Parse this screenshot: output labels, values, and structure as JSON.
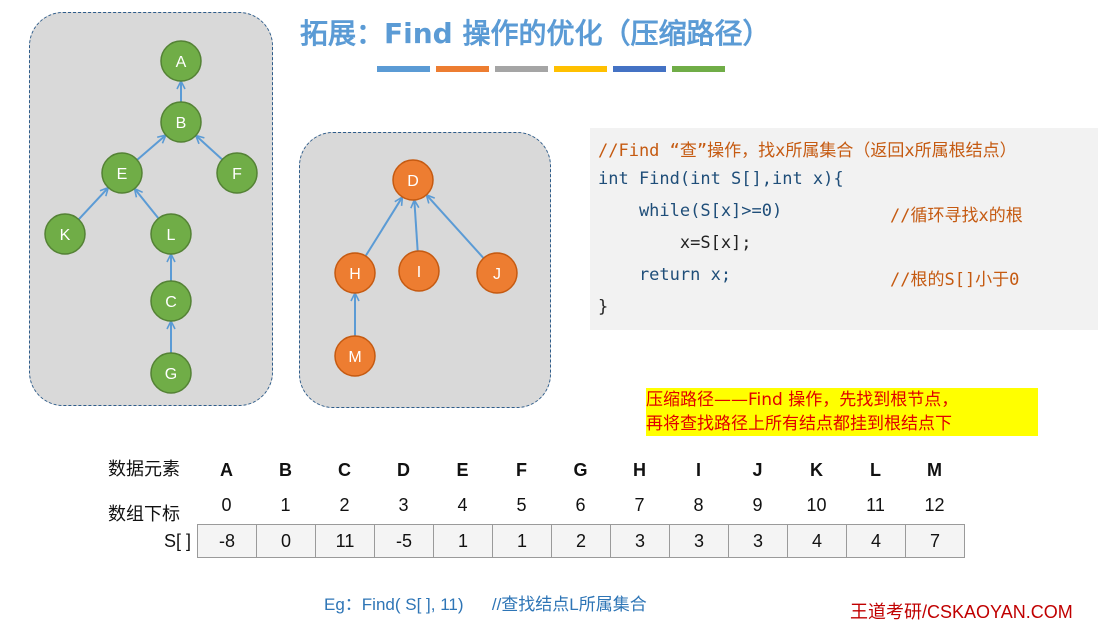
{
  "title": "拓展：Find 操作的优化（压缩路径）",
  "accent_bars": [
    "#5b9bd5",
    "#ed7d31",
    "#a5a5a5",
    "#ffc000",
    "#4472c4",
    "#70ad47"
  ],
  "colors": {
    "green_node": "#70ad47",
    "green_node_stroke": "#548235",
    "orange_node": "#ed7d31",
    "orange_node_stroke": "#c55a11",
    "edge": "#5b9bd5"
  },
  "tree_1": {
    "nodes": [
      "A",
      "B",
      "E",
      "F",
      "K",
      "L",
      "C",
      "G"
    ],
    "edges": [
      [
        "B",
        "A"
      ],
      [
        "E",
        "B"
      ],
      [
        "F",
        "B"
      ],
      [
        "K",
        "E"
      ],
      [
        "L",
        "E"
      ],
      [
        "C",
        "L"
      ],
      [
        "G",
        "C"
      ]
    ]
  },
  "tree_2": {
    "nodes": [
      "D",
      "H",
      "I",
      "J",
      "M"
    ],
    "edges": [
      [
        "H",
        "D"
      ],
      [
        "I",
        "D"
      ],
      [
        "J",
        "D"
      ],
      [
        "M",
        "H"
      ]
    ]
  },
  "code": {
    "comment": "//Find “查”操作，找x所属集合（返回x所属根结点）",
    "signature": "int Find(int S[],int x){",
    "while_stmt": "    while(S[x]>=0)",
    "while_comment": "//循环寻找x的根",
    "assign_stmt": "        x=S[x];",
    "return_stmt": "    return x;",
    "return_comment": "//根的S[]小于0",
    "closing": "}"
  },
  "note": {
    "line1": "压缩路径——Find 操作，先找到根节点，",
    "line2": "再将查找路径上所有结点都挂到根结点下"
  },
  "table": {
    "elements_label": "数据元素",
    "indices_label": "数组下标",
    "array_label": "S[ ]",
    "elements": [
      "A",
      "B",
      "C",
      "D",
      "E",
      "F",
      "G",
      "H",
      "I",
      "J",
      "K",
      "L",
      "M"
    ],
    "indices": [
      "0",
      "1",
      "2",
      "3",
      "4",
      "5",
      "6",
      "7",
      "8",
      "9",
      "10",
      "11",
      "12"
    ],
    "values": [
      "-8",
      "0",
      "11",
      "-5",
      "1",
      "1",
      "2",
      "3",
      "3",
      "3",
      "4",
      "4",
      "7"
    ]
  },
  "example": "Eg：Find( S[ ], 11)      //查找结点L所属集合",
  "brand": "王道考研/CSKAOYAN.COM"
}
